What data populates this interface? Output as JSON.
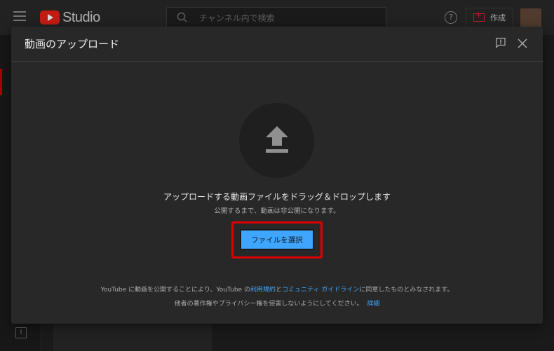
{
  "app": {
    "logo_text": "Studio",
    "search": {
      "placeholder": "チャンネル内で検索"
    },
    "help_symbol": "?",
    "create_label": "作成"
  },
  "dialog": {
    "title": "動画のアップロード",
    "drag_drop_text": "アップロードする動画ファイルをドラッグ＆ドロップします",
    "private_note": "公開するまで、動画は非公開になります。",
    "select_button_label": "ファイルを選択",
    "terms": {
      "part1": "YouTube に動画を公開することにより、YouTube の",
      "tos_link": "利用規約",
      "and": "と",
      "guidelines_link": "コミュニティ ガイドライン",
      "part2": "に同意したものとみなされます。",
      "line2": "他者の著作権やプライバシー権を侵害しないようにしてください。",
      "learn_more_link": "詳細"
    }
  },
  "colors": {
    "accent_blue": "#3ea6ff",
    "highlight_red": "#e00000",
    "youtube_red": "#e62117"
  }
}
